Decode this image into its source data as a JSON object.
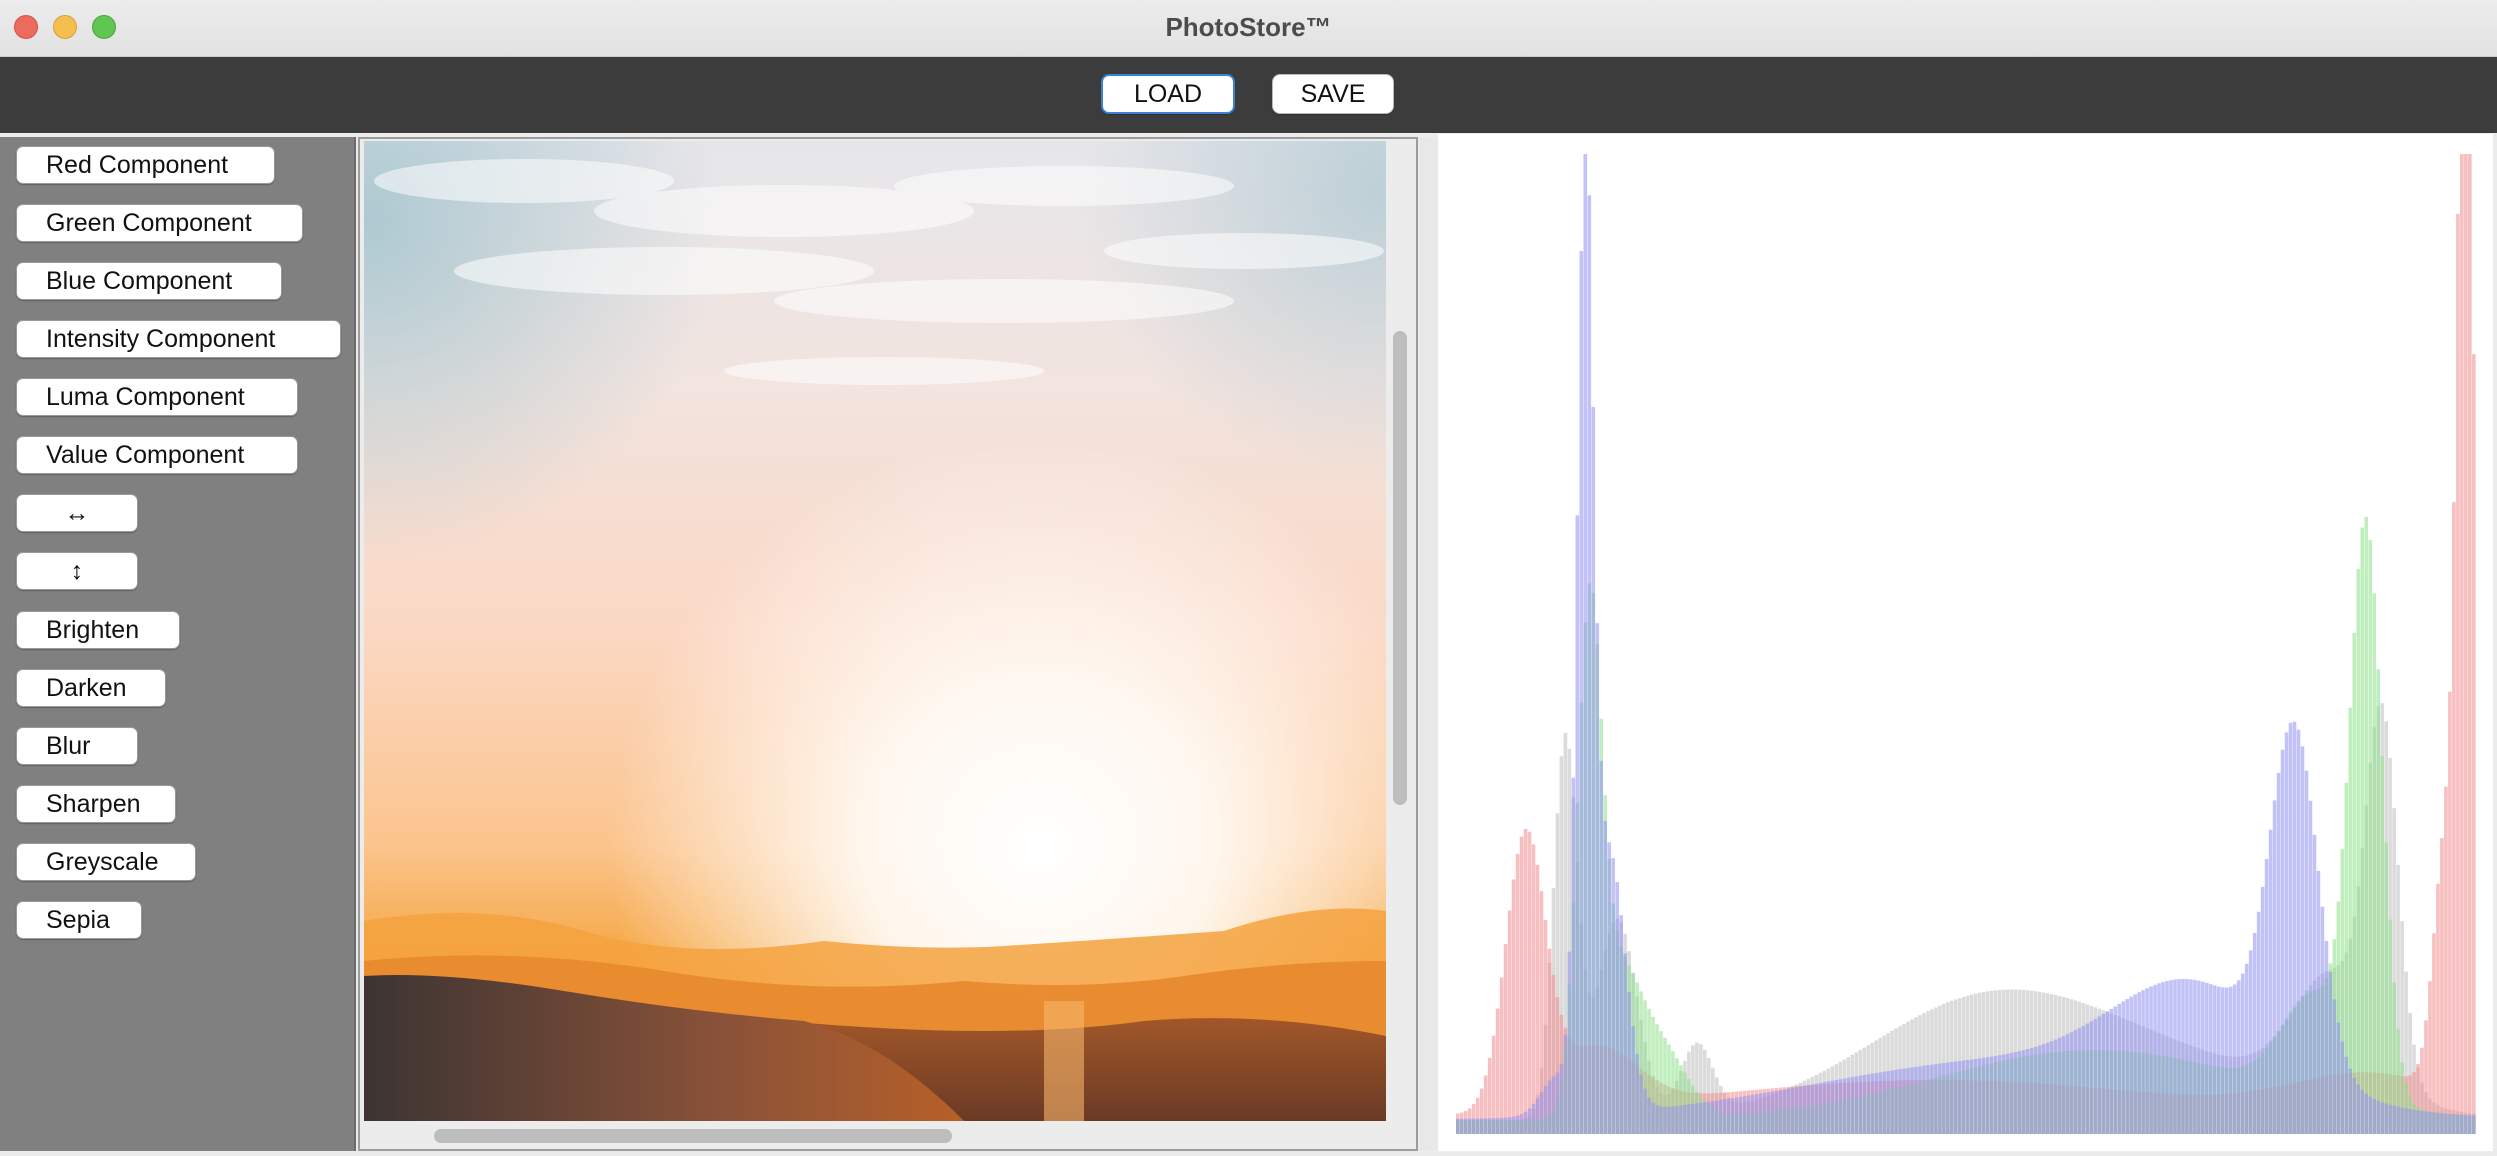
{
  "window": {
    "title": "PhotoStore™"
  },
  "toolbar": {
    "load_label": "LOAD",
    "save_label": "SAVE"
  },
  "sidebar": {
    "buttons": [
      {
        "label": "Red Component"
      },
      {
        "label": "Green Component"
      },
      {
        "label": "Blue Component"
      },
      {
        "label": "Intensity Component"
      },
      {
        "label": "Luma Component"
      },
      {
        "label": "Value Component"
      },
      {
        "label": "↔"
      },
      {
        "label": "↕"
      },
      {
        "label": "Brighten"
      },
      {
        "label": "Darken"
      },
      {
        "label": "Blur"
      },
      {
        "label": "Sharpen"
      },
      {
        "label": "Greyscale"
      },
      {
        "label": "Sepia"
      }
    ]
  },
  "image": {
    "description_icon": "sunset-photo"
  },
  "histogram": {
    "colors": {
      "red": "#f08a8a",
      "green": "#8de08a",
      "blue": "#8f8ff2",
      "intensity": "#bdbdbd"
    }
  }
}
